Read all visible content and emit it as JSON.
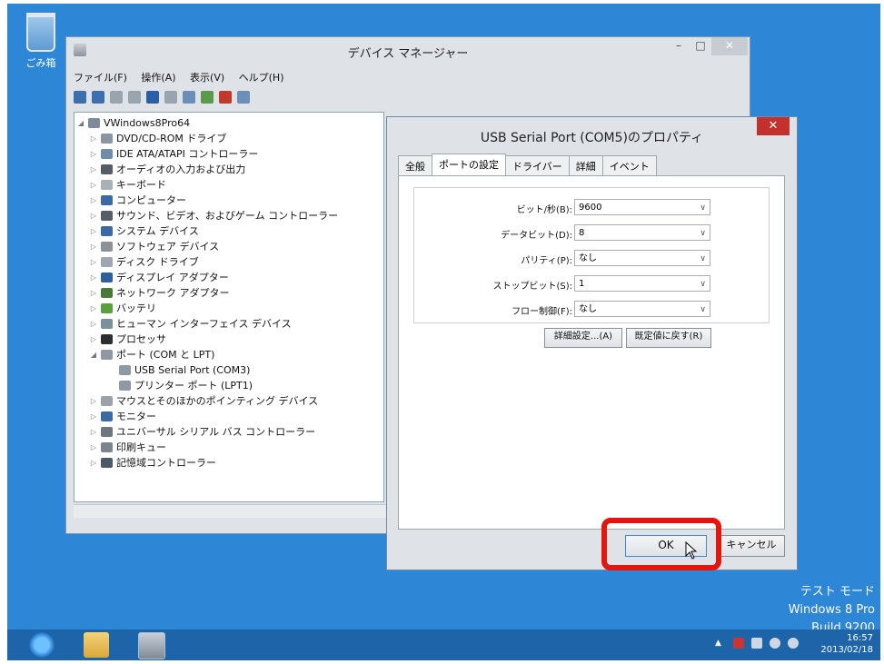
{
  "desktop": {
    "recycle_bin_label": "ごみ箱"
  },
  "devmgr": {
    "title": "デバイス マネージャー",
    "controls": {
      "minimize": "–",
      "maximize": "□",
      "close": "✕"
    },
    "menu": [
      "ファイル(F)",
      "操作(A)",
      "表示(V)",
      "ヘルプ(H)"
    ],
    "tree": [
      {
        "label": "VWindows8Pro64",
        "level": 0,
        "expander": "◢",
        "icon": "computer-icon"
      },
      {
        "label": "DVD/CD-ROM ドライブ",
        "level": 1,
        "expander": "▷",
        "icon": "disc-drive-icon"
      },
      {
        "label": "IDE ATA/ATAPI コントローラー",
        "level": 1,
        "expander": "▷",
        "icon": "ide-controller-icon"
      },
      {
        "label": "オーディオの入力および出力",
        "level": 1,
        "expander": "▷",
        "icon": "speaker-icon"
      },
      {
        "label": "キーボード",
        "level": 1,
        "expander": "▷",
        "icon": "keyboard-icon"
      },
      {
        "label": "コンピューター",
        "level": 1,
        "expander": "▷",
        "icon": "monitor-icon"
      },
      {
        "label": "サウンド、ビデオ、およびゲーム コントローラー",
        "level": 1,
        "expander": "▷",
        "icon": "speaker-icon"
      },
      {
        "label": "システム デバイス",
        "level": 1,
        "expander": "▷",
        "icon": "monitor-icon"
      },
      {
        "label": "ソフトウェア デバイス",
        "level": 1,
        "expander": "▷",
        "icon": "software-icon"
      },
      {
        "label": "ディスク ドライブ",
        "level": 1,
        "expander": "▷",
        "icon": "disk-icon"
      },
      {
        "label": "ディスプレイ アダプター",
        "level": 1,
        "expander": "▷",
        "icon": "display-icon"
      },
      {
        "label": "ネットワーク アダプター",
        "level": 1,
        "expander": "▷",
        "icon": "network-icon"
      },
      {
        "label": "バッテリ",
        "level": 1,
        "expander": "▷",
        "icon": "battery-icon"
      },
      {
        "label": "ヒューマン インターフェイス デバイス",
        "level": 1,
        "expander": "▷",
        "icon": "hid-icon"
      },
      {
        "label": "プロセッサ",
        "level": 1,
        "expander": "▷",
        "icon": "processor-icon"
      },
      {
        "label": "ポート (COM と LPT)",
        "level": 1,
        "expander": "◢",
        "icon": "port-icon"
      },
      {
        "label": "USB Serial Port (COM3)",
        "level": 2,
        "expander": "",
        "icon": "port-icon"
      },
      {
        "label": "プリンター ポート (LPT1)",
        "level": 2,
        "expander": "",
        "icon": "port-icon"
      },
      {
        "label": "マウスとそのほかのポインティング デバイス",
        "level": 1,
        "expander": "▷",
        "icon": "mouse-icon"
      },
      {
        "label": "モニター",
        "level": 1,
        "expander": "▷",
        "icon": "monitor-icon"
      },
      {
        "label": "ユニバーサル シリアル バス コントローラー",
        "level": 1,
        "expander": "▷",
        "icon": "usb-icon"
      },
      {
        "label": "印刷キュー",
        "level": 1,
        "expander": "▷",
        "icon": "printer-icon"
      },
      {
        "label": "記憶域コントローラー",
        "level": 1,
        "expander": "▷",
        "icon": "storage-icon"
      }
    ]
  },
  "dialog": {
    "title": "USB Serial Port (COM5)のプロパティ",
    "close": "✕",
    "tabs": [
      "全般",
      "ポートの設定",
      "ドライバー",
      "詳細",
      "イベント"
    ],
    "active_tab": "ポートの設定",
    "fields": [
      {
        "label": "ビット/秒(B):",
        "value": "9600"
      },
      {
        "label": "データビット(D):",
        "value": "8"
      },
      {
        "label": "パリティ(P):",
        "value": "なし"
      },
      {
        "label": "ストップビット(S):",
        "value": "1"
      },
      {
        "label": "フロー制御(F):",
        "value": "なし"
      }
    ],
    "dropdown_arrow": "∨",
    "advanced_button": "詳細設定...(A)",
    "restore_button": "既定値に戻す(R)",
    "ok_button": "OK",
    "cancel_button": "キャンセル"
  },
  "watermark": {
    "line1": "テスト モード",
    "line2": "Windows 8 Pro",
    "line3": "Build 9200"
  },
  "clock": {
    "time": "16:57",
    "date": "2013/02/18"
  },
  "tray_arrow": "▲",
  "colors": {
    "desktop": "#2e86d6",
    "taskbar": "#1d64a8",
    "highlight": "#e3160e",
    "close_red": "#c4302b"
  }
}
